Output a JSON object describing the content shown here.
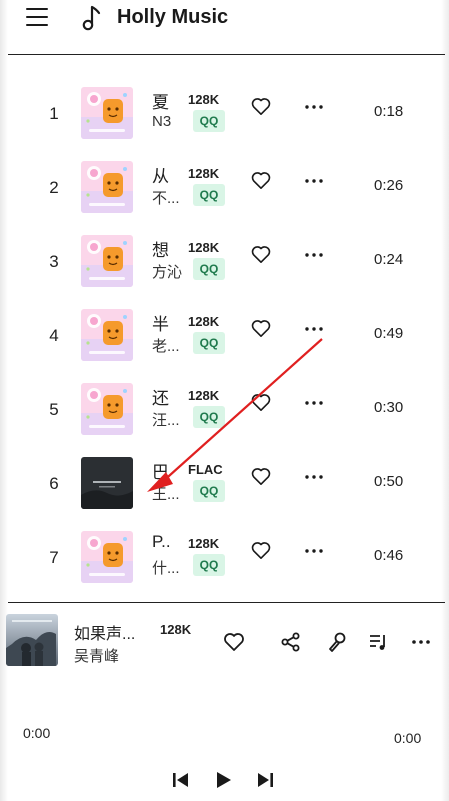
{
  "header": {
    "menu_icon": "hamburger-menu-icon",
    "logo_icon": "music-note-icon",
    "title": "Holly Music"
  },
  "songs": [
    {
      "index": "1",
      "title": "夏",
      "artist": "N3",
      "quality": "128K",
      "source": "QQ",
      "duration": "0:18",
      "cover": "pink-cartoon-cover"
    },
    {
      "index": "2",
      "title": "从",
      "artist": "不...",
      "quality": "128K",
      "source": "QQ",
      "duration": "0:26",
      "cover": "pink-cartoon-cover"
    },
    {
      "index": "3",
      "title": "想",
      "artist": "方沁",
      "quality": "128K",
      "source": "QQ",
      "duration": "0:24",
      "cover": "pink-cartoon-cover"
    },
    {
      "index": "4",
      "title": "半",
      "artist": "老...",
      "quality": "128K",
      "source": "QQ",
      "duration": "0:49",
      "cover": "pink-cartoon-cover"
    },
    {
      "index": "5",
      "title": "还",
      "artist": "汪...",
      "quality": "128K",
      "source": "QQ",
      "duration": "0:30",
      "cover": "pink-cartoon-cover"
    },
    {
      "index": "6",
      "title": "巴",
      "artist": "王...",
      "quality": "FLAC",
      "source": "QQ",
      "duration": "0:50",
      "cover": "dark-photo-cover"
    },
    {
      "index": "7",
      "title": "P..",
      "artist": "什...",
      "quality": "128K",
      "source": "QQ",
      "duration": "0:46",
      "cover": "pink-cartoon-cover"
    }
  ],
  "player": {
    "title": "如果声...",
    "artist": "吴青峰",
    "quality": "128K",
    "time_current": "0:00",
    "time_total": "0:00",
    "icons": [
      "heart-icon",
      "share-icon",
      "microphone-icon",
      "playlist-icon",
      "more-icon",
      "previous-icon",
      "play-icon",
      "next-icon"
    ]
  },
  "colors": {
    "badge_bg": "#d9f5e6",
    "badge_text": "#1f7a4d",
    "arrow": "#e02020"
  }
}
